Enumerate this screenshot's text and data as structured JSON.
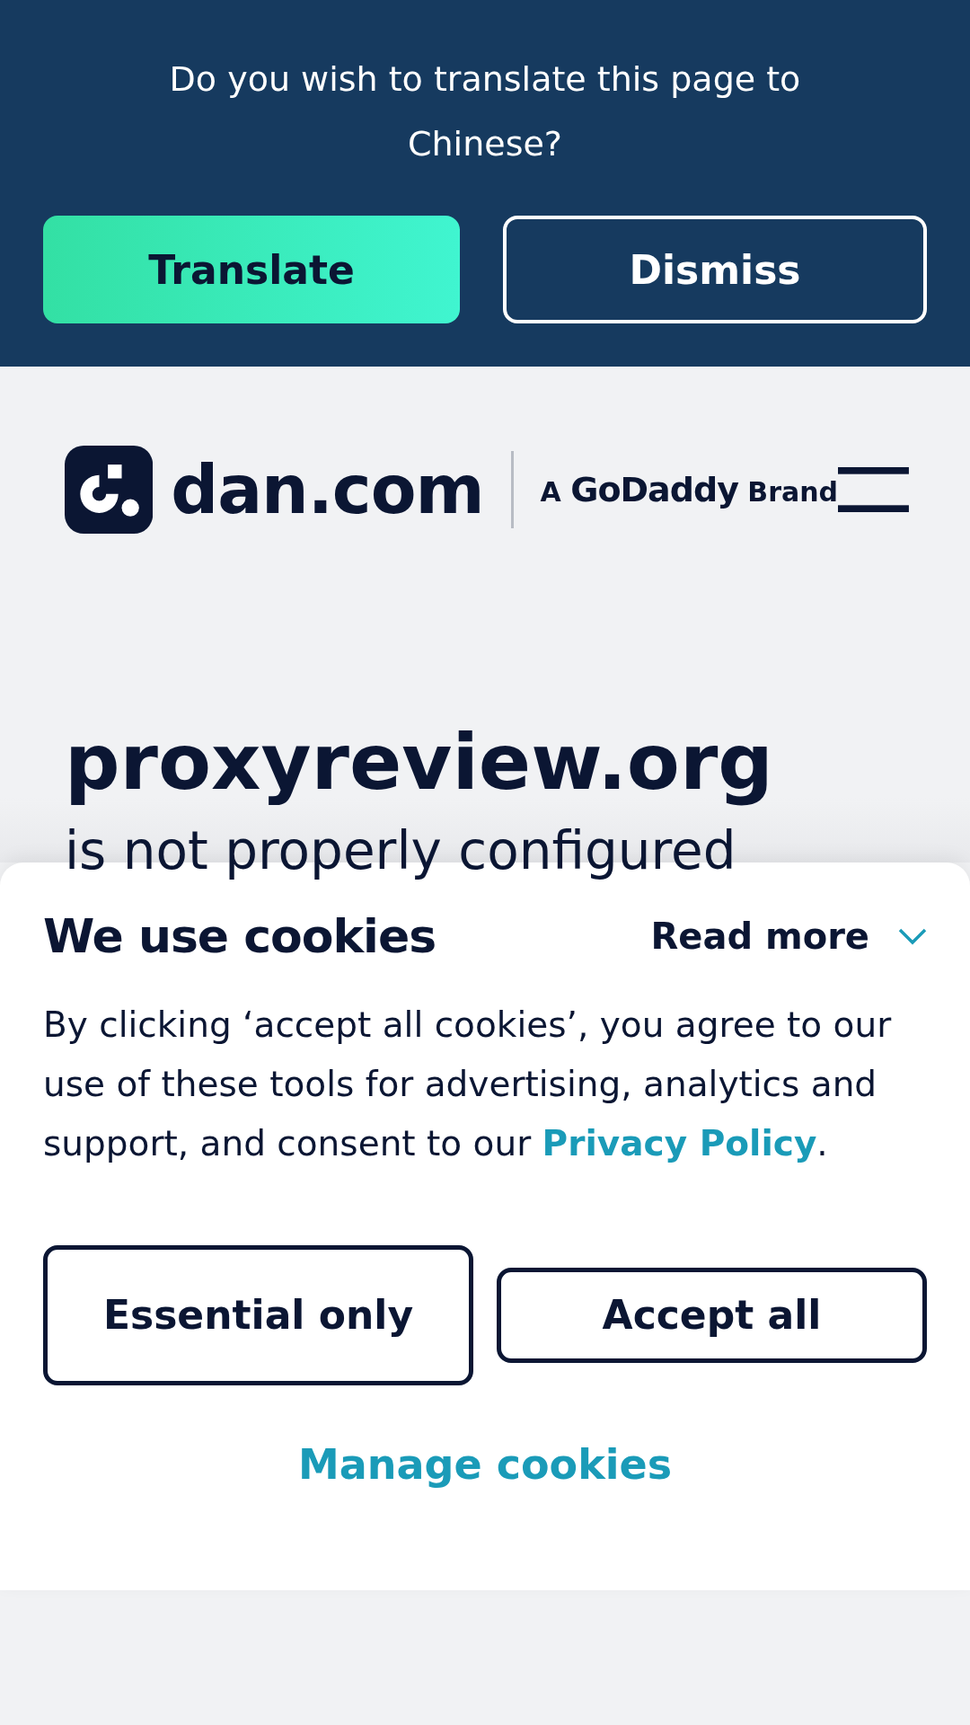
{
  "translate_bar": {
    "question": "Do you wish to translate this page to Chinese?",
    "buttons": [
      {
        "label": "Translate",
        "kind": "primary"
      },
      {
        "label": "Dismiss",
        "kind": "outline"
      }
    ]
  },
  "header": {
    "logo_text": "dan.com",
    "tagline": "A **GoDaddy** Brand"
  },
  "main": {
    "domain": "proxyreview.org",
    "status": "is not properly configured"
  },
  "cookie_banner": {
    "title": "We use cookies",
    "read_more": "Read more",
    "expanded": false,
    "body": "By clicking ‘accept all cookies’, you agree to our use of these tools for advertising, analytics and support, and consent to our ",
    "link": "Privacy Policy",
    "body_end": ".",
    "buttons": [
      {
        "label": "Essential only"
      },
      {
        "label": "Accept all"
      }
    ],
    "manage": "Manage cookies"
  }
}
